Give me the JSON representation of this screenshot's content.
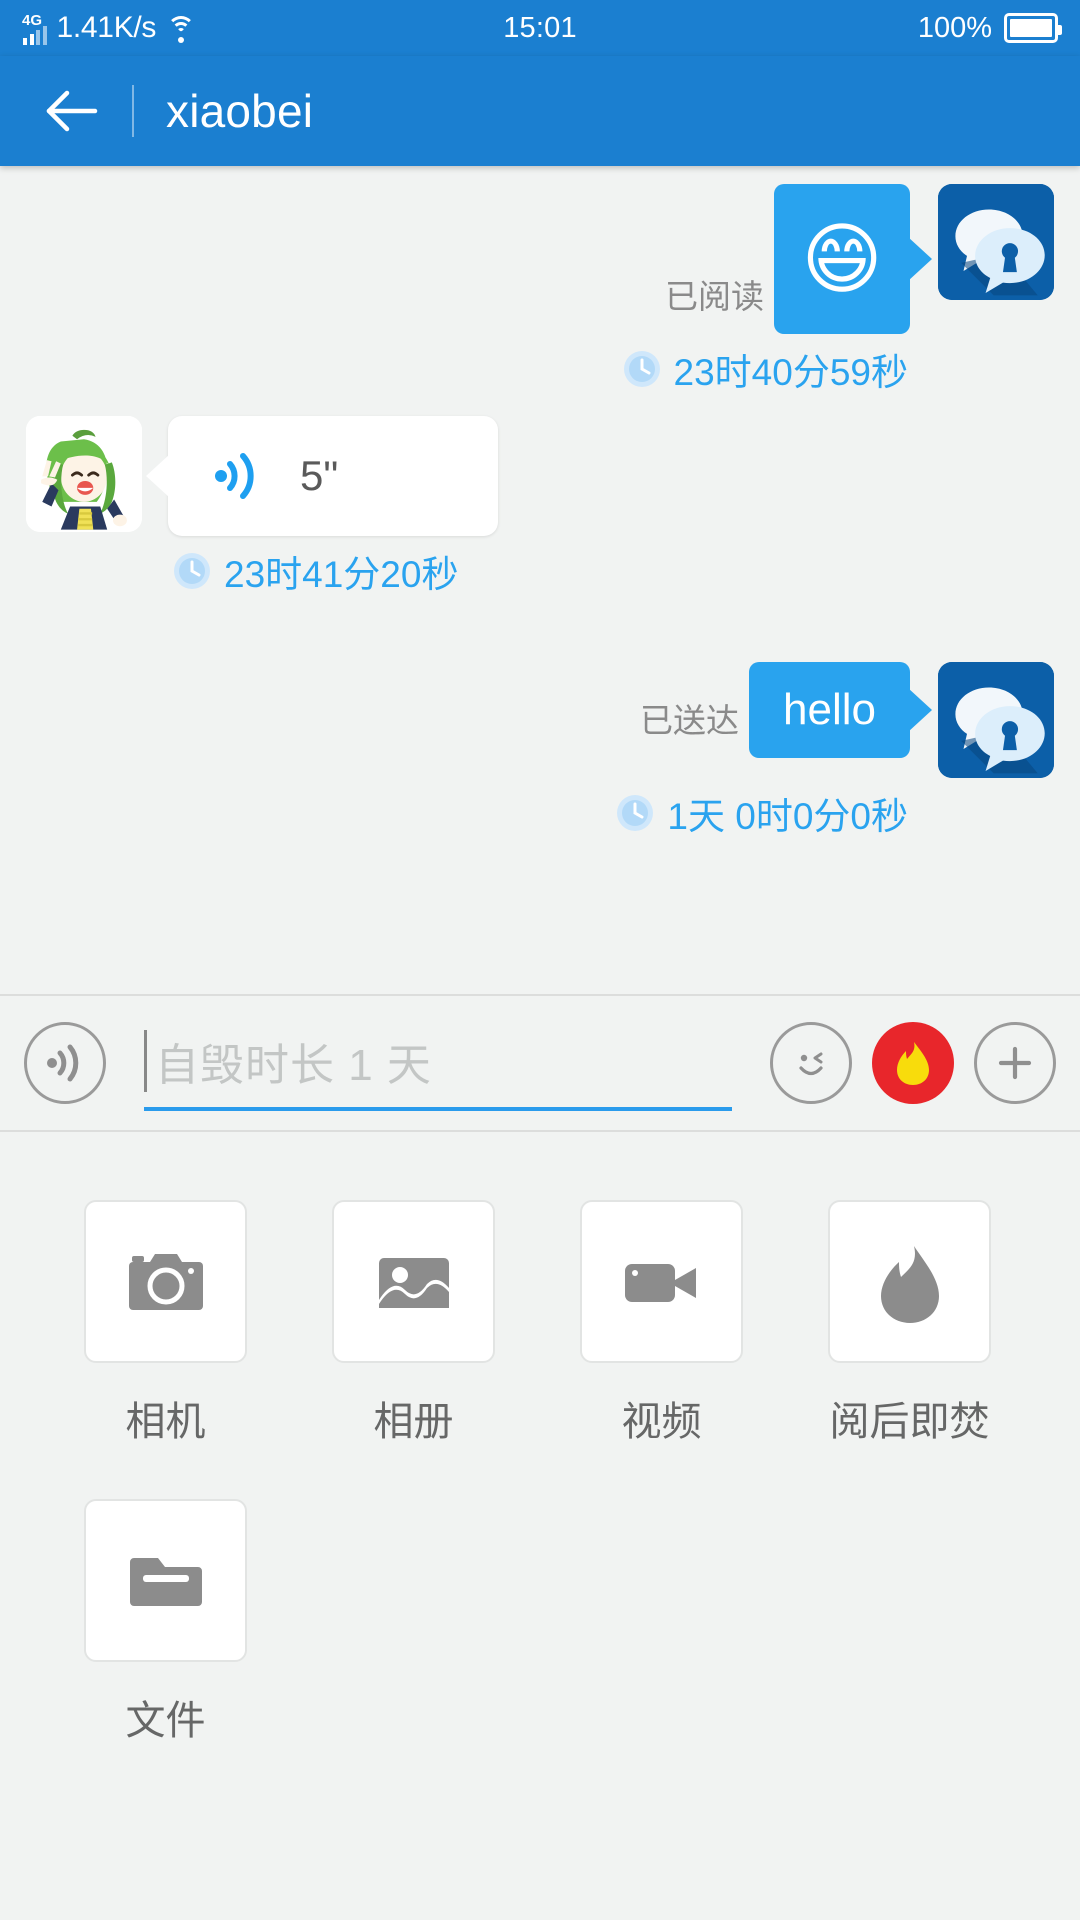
{
  "status_bar": {
    "network_type": "4G",
    "net_speed": "1.41K/s",
    "wifi_icon": "wifi-icon",
    "clock": "15:01",
    "battery_percent": "100%",
    "battery_icon": "battery-icon"
  },
  "title_bar": {
    "back_icon": "back-arrow-icon",
    "title": "xiaobei"
  },
  "chat": {
    "messages": [
      {
        "direction": "outgoing",
        "type": "sticker",
        "status_label": "已阅读",
        "emoji": "😄",
        "time": "23时40分59秒",
        "clock_icon": "clock-icon",
        "avatar_icon": "secure-chat-avatar-icon"
      },
      {
        "direction": "incoming",
        "type": "voice",
        "duration": "5\"",
        "voice_icon": "voice-wave-icon",
        "time": "23时41分20秒",
        "clock_icon": "clock-icon",
        "avatar_icon": "anime-girl-avatar-icon"
      },
      {
        "direction": "outgoing",
        "type": "text",
        "status_label": "已送达",
        "text": "hello",
        "time": "1天 0时0分0秒",
        "clock_icon": "clock-icon",
        "avatar_icon": "secure-chat-avatar-icon"
      }
    ]
  },
  "input_bar": {
    "voice_icon": "voice-record-icon",
    "placeholder": "自毁时长 1 天",
    "value": "",
    "emoji_icon": "wink-face-icon",
    "burn_icon": "flame-icon",
    "add_icon": "plus-icon"
  },
  "attachments": {
    "items": [
      {
        "label": "相机",
        "icon": "camera-icon"
      },
      {
        "label": "相册",
        "icon": "photo-album-icon"
      },
      {
        "label": "视频",
        "icon": "video-camera-icon"
      },
      {
        "label": "阅后即焚",
        "icon": "flame-icon"
      },
      {
        "label": "文件",
        "icon": "folder-icon"
      }
    ]
  },
  "colors": {
    "brand_blue": "#1b7fd0",
    "bubble_blue": "#29a3ee",
    "time_blue": "#2aa3ef",
    "burn_red": "#e8262b",
    "flame_yellow": "#f8dc0c",
    "background": "#f1f3f2"
  }
}
